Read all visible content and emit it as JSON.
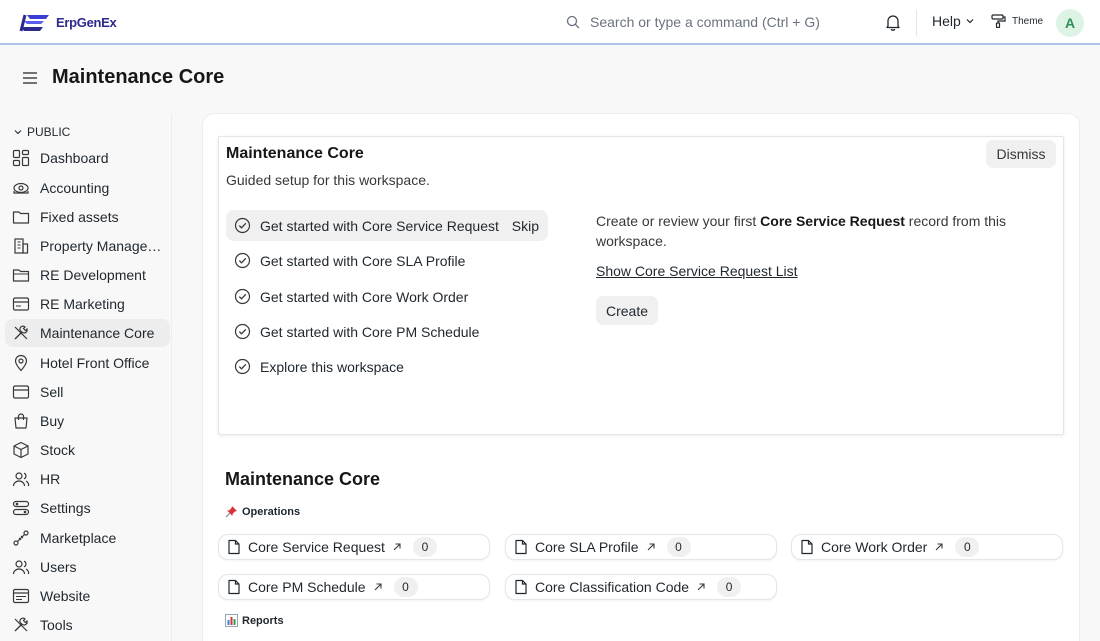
{
  "navbar": {
    "logo_text": "ErpGenEx",
    "search_placeholder": "Search or type a command (Ctrl + G)",
    "help_label": "Help",
    "theme_label": "Theme",
    "avatar_initial": "A"
  },
  "page": {
    "title": "Maintenance Core"
  },
  "sidebar": {
    "section_label": "PUBLIC",
    "items": [
      {
        "label": "Dashboard",
        "icon": "dashboard-icon"
      },
      {
        "label": "Accounting",
        "icon": "accounting-icon"
      },
      {
        "label": "Fixed assets",
        "icon": "folder-icon"
      },
      {
        "label": "Property Management",
        "icon": "building-icon"
      },
      {
        "label": "RE Development",
        "icon": "folder-icon"
      },
      {
        "label": "RE Marketing",
        "icon": "card-icon"
      },
      {
        "label": "Maintenance Core",
        "icon": "tools-icon",
        "active": true
      },
      {
        "label": "Hotel Front Office",
        "icon": "map-pin-icon"
      },
      {
        "label": "Sell",
        "icon": "card-icon"
      },
      {
        "label": "Buy",
        "icon": "bag-icon"
      },
      {
        "label": "Stock",
        "icon": "box-icon"
      },
      {
        "label": "HR",
        "icon": "users-icon"
      },
      {
        "label": "Settings",
        "icon": "settings-icon"
      },
      {
        "label": "Marketplace",
        "icon": "integration-icon"
      },
      {
        "label": "Users",
        "icon": "users-icon"
      },
      {
        "label": "Website",
        "icon": "website-icon"
      },
      {
        "label": "Tools",
        "icon": "tools-icon"
      }
    ]
  },
  "onboarding": {
    "title": "Maintenance Core",
    "subtitle": "Guided setup for this workspace.",
    "dismiss_label": "Dismiss",
    "steps": [
      {
        "label": "Get started with Core Service Request",
        "active": true
      },
      {
        "label": "Get started with Core SLA Profile"
      },
      {
        "label": "Get started with Core Work Order"
      },
      {
        "label": "Get started with Core PM Schedule"
      },
      {
        "label": "Explore this workspace"
      }
    ],
    "skip_label": "Skip",
    "detail_prefix": "Create or review your first ",
    "detail_bold": "Core Service Request",
    "detail_suffix": " record from this workspace.",
    "show_link": "Show Core Service Request List",
    "create_label": "Create"
  },
  "workspace": {
    "title": "Maintenance Core",
    "groups": [
      {
        "label": "Operations",
        "icon": "pushpin-icon"
      },
      {
        "label": "Reports",
        "icon": "bar-chart-icon"
      }
    ],
    "shortcuts": [
      {
        "label": "Core Service Request",
        "count": "0"
      },
      {
        "label": "Core SLA Profile",
        "count": "0"
      },
      {
        "label": "Core Work Order",
        "count": "0"
      },
      {
        "label": "Core PM Schedule",
        "count": "0"
      },
      {
        "label": "Core Classification Code",
        "count": "0"
      }
    ]
  }
}
